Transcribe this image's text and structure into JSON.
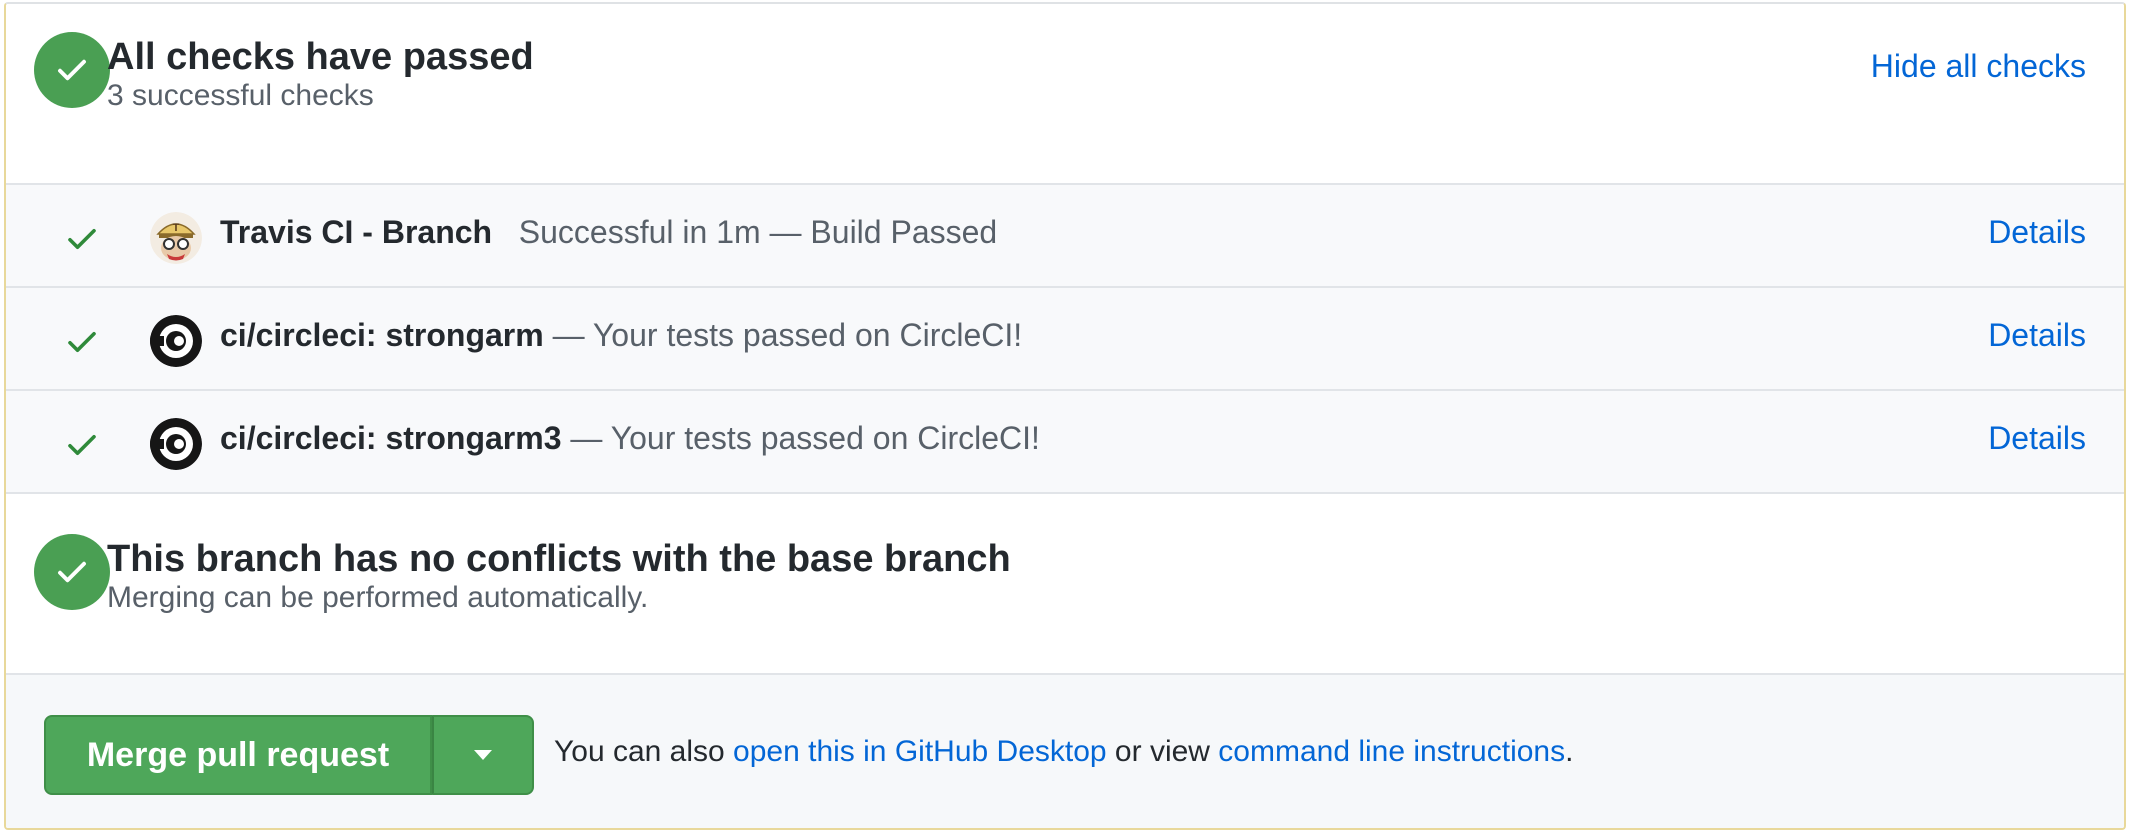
{
  "status": {
    "title": "All checks have passed",
    "subtitle": "3 successful checks",
    "hide_link": "Hide all checks"
  },
  "checks": [
    {
      "context": "Travis CI - Branch",
      "description": "Successful in 1m — Build Passed",
      "details": "Details",
      "icon": "travis-ci-mascot-icon"
    },
    {
      "context": "ci/circleci: strongarm",
      "description": "— Your tests passed on CircleCI!",
      "details": "Details",
      "icon": "circleci-logo-icon"
    },
    {
      "context": "ci/circleci: strongarm3",
      "description": "— Your tests passed on CircleCI!",
      "details": "Details",
      "icon": "circleci-logo-icon"
    }
  ],
  "merge_status": {
    "title": "This branch has no conflicts with the base branch",
    "subtitle": "Merging can be performed automatically."
  },
  "footer": {
    "merge_button": "Merge pull request",
    "text_prefix": "You can also ",
    "desktop_link": "open this in GitHub Desktop",
    "text_middle": " or view ",
    "cli_link": "command line instructions",
    "text_suffix": "."
  },
  "colors": {
    "success": "#4a9f53",
    "link": "#0366d6",
    "merge_button": "#4ea75a"
  }
}
